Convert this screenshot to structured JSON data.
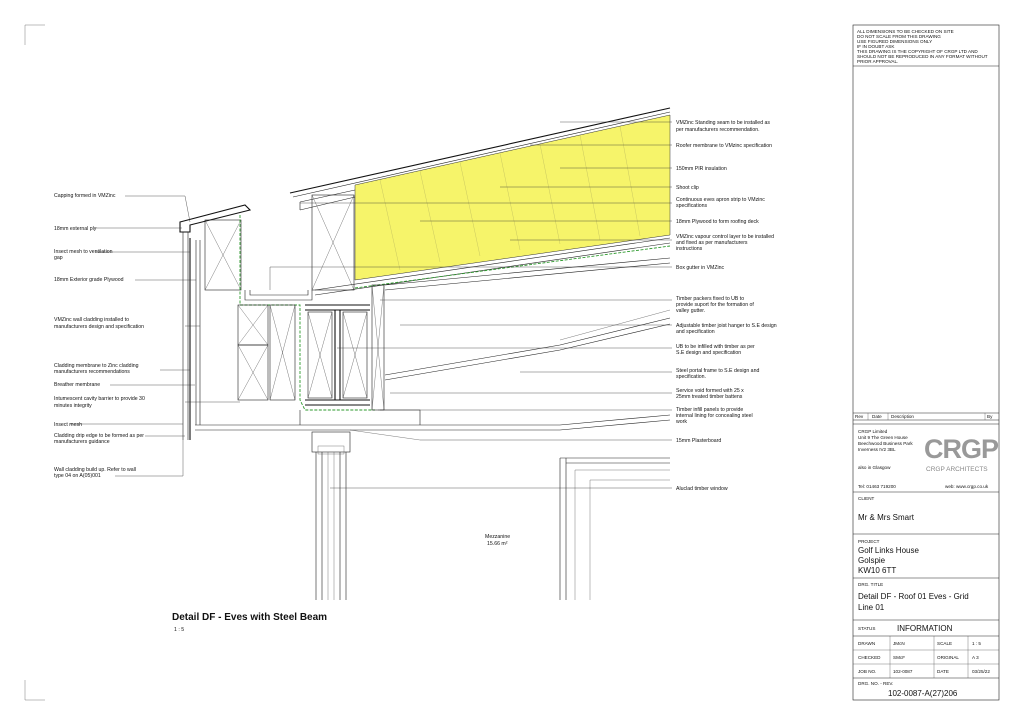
{
  "notes": {
    "line1": "ALL DIMENSIONS TO BE CHECKED ON SITE",
    "line2": "DO NOT SCALE FROM THIS DRAWING",
    "line3": "USE FIGURED DIMENSIONS ONLY",
    "line4": "IF IN DOUBT ASK",
    "line5": "THIS DRAWING IS THE COPYRIGHT OF CRGP LTD AND",
    "line6": "SHOULD NOT BE REPRODUCED IN ANY FORMAT WITHOUT",
    "line7": "PRIOR APPROVAL."
  },
  "revisions": {
    "rev": "Rev",
    "date": "Date",
    "description": "Description",
    "by": "By"
  },
  "company": {
    "name": "CRGP Limited",
    "addr1": "Unit 9 The Green House",
    "addr2": "Beechwood Business Park",
    "addr3": "Inverness IV2 3BL",
    "also": "also in Glasgow",
    "tel": "Tel: 01463 719200",
    "web": "web: www.crgp.co.uk",
    "logo": "CRGP",
    "logo_sub": "CRGP ARCHITECTS"
  },
  "client": {
    "label": "CLIENT",
    "value": "Mr & Mrs Smart"
  },
  "project": {
    "label": "PROJECT",
    "line1": "Golf Links House",
    "line2": "Golspie",
    "line3": "KW10 6TT"
  },
  "title": {
    "label": "DRG. TITLE",
    "line1": "Detail DF - Roof 01 Eves - Grid",
    "line2": "Line 01"
  },
  "status": {
    "label": "STATUS",
    "value": "INFORMATION"
  },
  "meta": {
    "drawn_label": "DRAWN",
    "drawn": "JMcN",
    "scale_label": "SCALE",
    "scale": "1 : 5",
    "checked_label": "CHECKED",
    "checked": "SMcF",
    "original_label": "ORIGINAL",
    "original": "A 3",
    "job_label": "JOB NO.",
    "job": "102-0087",
    "date_label": "DATE",
    "date": "03/25/22"
  },
  "drawing_no": {
    "label": "DRG. NO. - REV.",
    "value": "102-0087-A(27)206"
  },
  "detail": {
    "title": "Detail DF - Eves with Steel Beam",
    "scale": "1 : 5"
  },
  "room": {
    "name": "Mezzanine",
    "area": "15.66 m²"
  },
  "labels_left": [
    "Capping formed in VMZinc",
    "18mm external ply",
    "Insect mesh to ventilation",
    "gap",
    "18mm Exterior grade Plywood",
    "VMZinc wall cladding installed to",
    "manufacturers design and specification",
    "Cladding membrane to Zinc cladding",
    "manufacturers recommendations",
    "Breather membrane",
    "Intumescent cavity barrier to provide 30",
    "minutes integrity",
    "Insect mesh",
    "Cladding drip edge to be formed as per",
    "manufacturers guidance",
    "Wall cladding build up. Refer to wall",
    "type 04 on A(05)001"
  ],
  "labels_right": [
    "VMZinc Standing seam to be installed as",
    "per manufacturers recommendation.",
    "Roofer membrane to VMzinc specification",
    "150mm PIR insulation",
    "Shoot clip",
    "Continuous eves apron strip to VMzinc",
    "specifications",
    "18mm Plywood to form roofing deck",
    "VMZinc vapour control layer to be installed",
    "and fixed as per manufacturers",
    "instructions",
    "Box gutter in VMZinc",
    "Timber packers fixed to UB to",
    "provide suport for the formation of",
    "valley gutter.",
    "Adjustable timber joist hanger to S.E design",
    "and specification",
    "UB to be infilled with timber as per",
    "S.E design and specification",
    "Steel portal frame to S.E design and",
    "specification.",
    "Service void formed with 25 x",
    "25mm treated timber battens",
    "Timber infill panels to provide",
    "internal lining for concealing steel",
    "work",
    "15mm Plasterboard",
    "Aluclad timber window"
  ],
  "colors": {
    "insulation": "#f6f46a",
    "membrane": "#2e9a2e"
  }
}
